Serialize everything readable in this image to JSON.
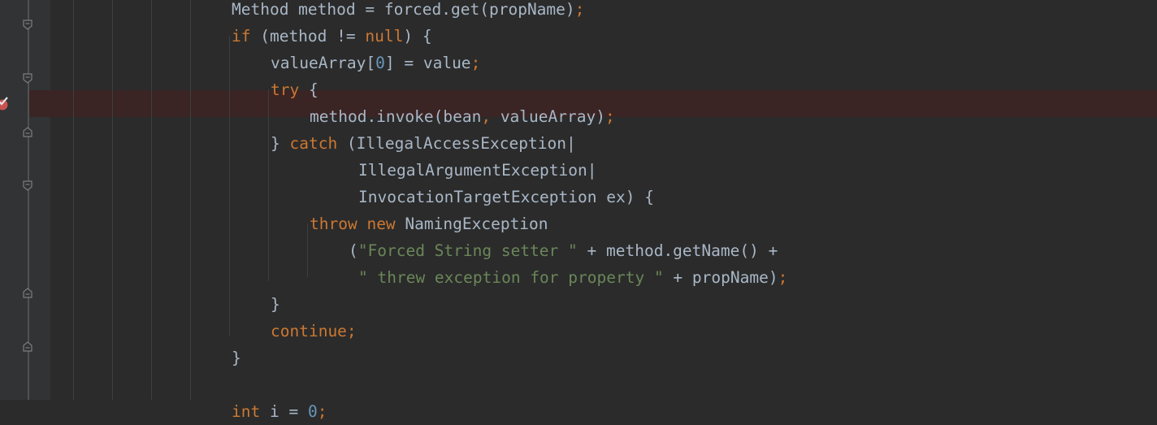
{
  "editor": {
    "lines": [
      [
        {
          "t": "Method method = forced.get(propName)",
          "c": "plain"
        },
        {
          "t": ";",
          "c": "punc"
        }
      ],
      [
        {
          "t": "if",
          "c": "kw"
        },
        {
          "t": " (method != ",
          "c": "plain"
        },
        {
          "t": "null",
          "c": "kw"
        },
        {
          "t": ") {",
          "c": "plain"
        }
      ],
      [
        {
          "t": "valueArray[",
          "c": "plain"
        },
        {
          "t": "0",
          "c": "num"
        },
        {
          "t": "] = value",
          "c": "plain"
        },
        {
          "t": ";",
          "c": "punc"
        }
      ],
      [
        {
          "t": "try",
          "c": "kw"
        },
        {
          "t": " {",
          "c": "plain"
        }
      ],
      [
        {
          "t": "method.invoke(bean",
          "c": "plain"
        },
        {
          "t": ",",
          "c": "punc"
        },
        {
          "t": " valueArray)",
          "c": "plain"
        },
        {
          "t": ";",
          "c": "punc"
        }
      ],
      [
        {
          "t": "} ",
          "c": "plain"
        },
        {
          "t": "catch",
          "c": "kw"
        },
        {
          "t": " (IllegalAccessException|",
          "c": "plain"
        }
      ],
      [
        {
          "t": "IllegalArgumentException|",
          "c": "plain"
        }
      ],
      [
        {
          "t": "InvocationTargetException ex) {",
          "c": "plain"
        }
      ],
      [
        {
          "t": "throw",
          "c": "kw"
        },
        {
          "t": " ",
          "c": "plain"
        },
        {
          "t": "new",
          "c": "kw"
        },
        {
          "t": " NamingException",
          "c": "plain"
        }
      ],
      [
        {
          "t": "(",
          "c": "plain"
        },
        {
          "t": "\"Forced String setter \"",
          "c": "str"
        },
        {
          "t": " + method.getName() +",
          "c": "plain"
        }
      ],
      [
        {
          "t": "\" threw exception for property \"",
          "c": "str"
        },
        {
          "t": " + propName)",
          "c": "plain"
        },
        {
          "t": ";",
          "c": "punc"
        }
      ],
      [
        {
          "t": "}",
          "c": "plain"
        }
      ],
      [
        {
          "t": "continue",
          "c": "kw"
        },
        {
          "t": ";",
          "c": "punc"
        }
      ],
      [
        {
          "t": "}",
          "c": "plain"
        }
      ],
      [],
      [
        {
          "t": "int",
          "c": "kw"
        },
        {
          "t": " i = ",
          "c": "plain"
        },
        {
          "t": "0",
          "c": "num"
        },
        {
          "t": ";",
          "c": "punc"
        }
      ]
    ]
  },
  "gutter": {
    "breakpoint_icon": "breakpoint-check-icon",
    "fold_icons": [
      "fold-open-icon",
      "fold-open-icon",
      "fold-close-icon",
      "fold-open-icon",
      "fold-close-icon",
      "fold-close-icon"
    ]
  },
  "colors": {
    "background": "#2b2b2b",
    "gutter": "#313335",
    "keyword": "#cc7832",
    "string": "#6a8759",
    "number": "#6897bb",
    "text": "#a9b7c6",
    "breakpoint_line": "#3b2424",
    "breakpoint": "#c75450"
  }
}
